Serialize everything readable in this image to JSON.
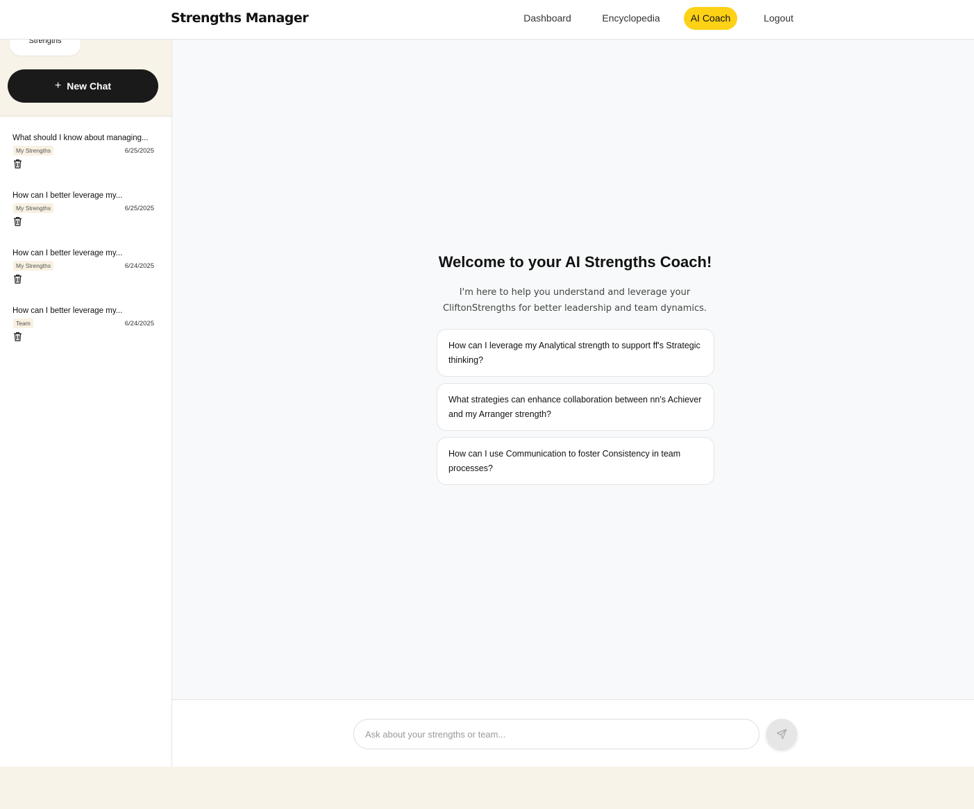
{
  "navbar": {
    "brand": "Strengths Manager",
    "items": [
      {
        "label": "Dashboard",
        "active": false
      },
      {
        "label": "Encyclopedia",
        "active": false
      },
      {
        "label": "AI Coach",
        "active": true
      },
      {
        "label": "Logout",
        "active": false
      }
    ],
    "accent_color": "#fcd116"
  },
  "sidebar": {
    "context_pill": "Strengths",
    "new_chat": {
      "icon": "plus-icon",
      "label": "New Chat"
    },
    "chats": [
      {
        "title": "What should I know about managing...",
        "tag": "My Strengths",
        "date": "6/25/2025",
        "delete_icon": "trash-icon"
      },
      {
        "title": "How can I better leverage my...",
        "tag": "My Strengths",
        "date": "6/25/2025",
        "delete_icon": "trash-icon"
      },
      {
        "title": "How can I better leverage my...",
        "tag": "My Strengths",
        "date": "6/24/2025",
        "delete_icon": "trash-icon"
      },
      {
        "title": "How can I better leverage my...",
        "tag": "Team",
        "date": "6/24/2025",
        "delete_icon": "trash-icon"
      }
    ]
  },
  "main": {
    "welcome_title": "Welcome to your AI Strengths Coach!",
    "welcome_subtitle": "I'm here to help you understand and leverage your CliftonStrengths for better leadership and team dynamics.",
    "suggestions": [
      "How can I leverage my Analytical strength to support ff's Strategic thinking?",
      "What strategies can enhance collaboration between nn's Achiever and my Arranger strength?",
      "How can I use Communication to foster Consistency in team processes?"
    ]
  },
  "input": {
    "placeholder": "Ask about your strengths or team...",
    "value": "",
    "send_icon": "send-icon"
  }
}
